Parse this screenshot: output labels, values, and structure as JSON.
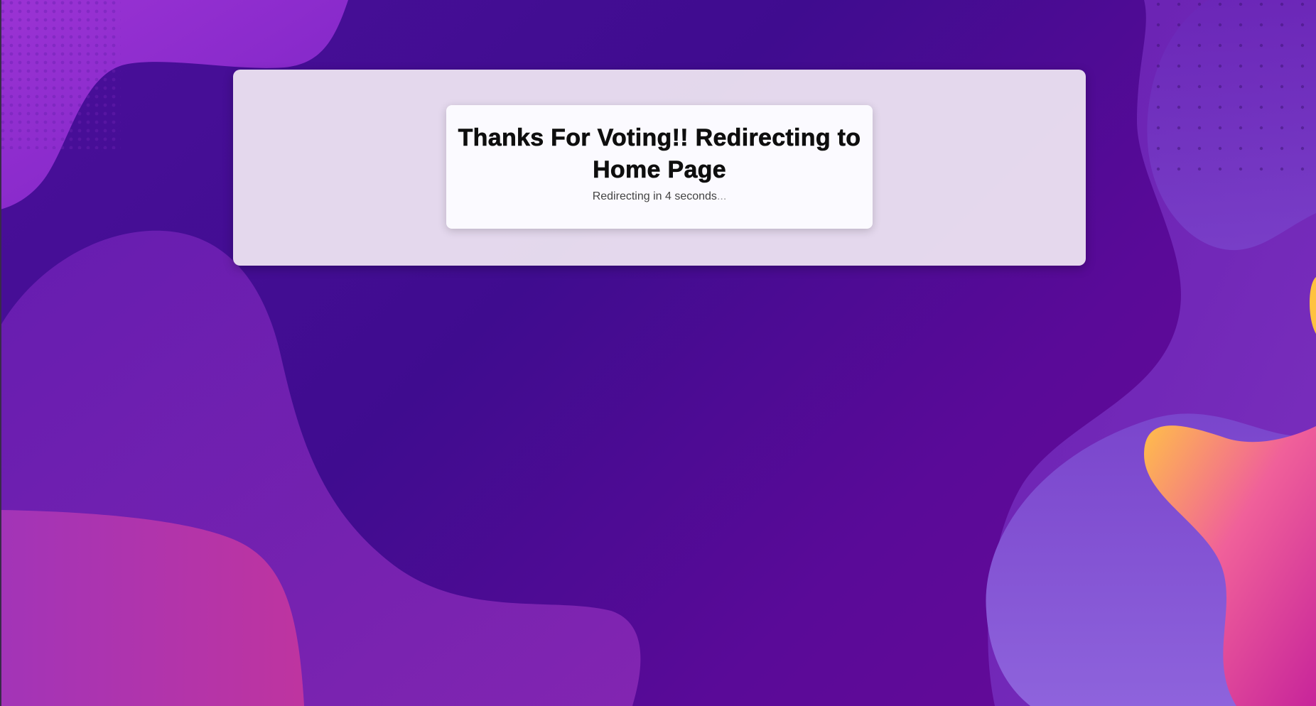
{
  "message": {
    "title": "Thanks For Voting!! Redirecting to Home Page",
    "status_prefix": "Redirecting in ",
    "countdown": "4",
    "status_suffix": " seconds",
    "ellipsis": "..."
  },
  "colors": {
    "background": "#4a0f9a",
    "panel": "#eee6f2",
    "card": "#fbfaff",
    "title_text": "#0e0e0e",
    "status_text": "#444444"
  }
}
